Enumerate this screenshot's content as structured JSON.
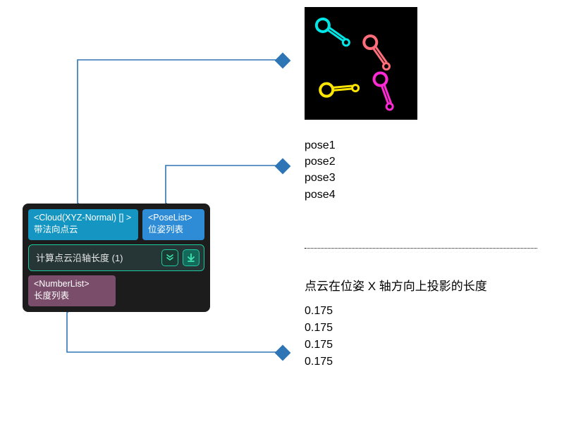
{
  "node": {
    "cloud_port": {
      "type": "<Cloud(XYZ-Normal) [] >",
      "label": "带法向点云"
    },
    "pose_port": {
      "type": "<PoseList>",
      "label": "位姿列表"
    },
    "title": "计算点云沿轴长度 (1)",
    "out_port": {
      "type": "<NumberList>",
      "label": "长度列表"
    }
  },
  "poses": [
    "pose1",
    "pose2",
    "pose3",
    "pose4"
  ],
  "projection_title": "点云在位姿 X 轴方向上投影的长度",
  "values": [
    "0.175",
    "0.175",
    "0.175",
    "0.175"
  ],
  "parts": [
    {
      "color": "#00e5e5",
      "rot": 35
    },
    {
      "color": "#ff6e7a",
      "rot": 55
    },
    {
      "color": "#ffe600",
      "rot": -5
    },
    {
      "color": "#ff2ad4",
      "rot": 70
    }
  ],
  "wire_color": "#2e75b6"
}
